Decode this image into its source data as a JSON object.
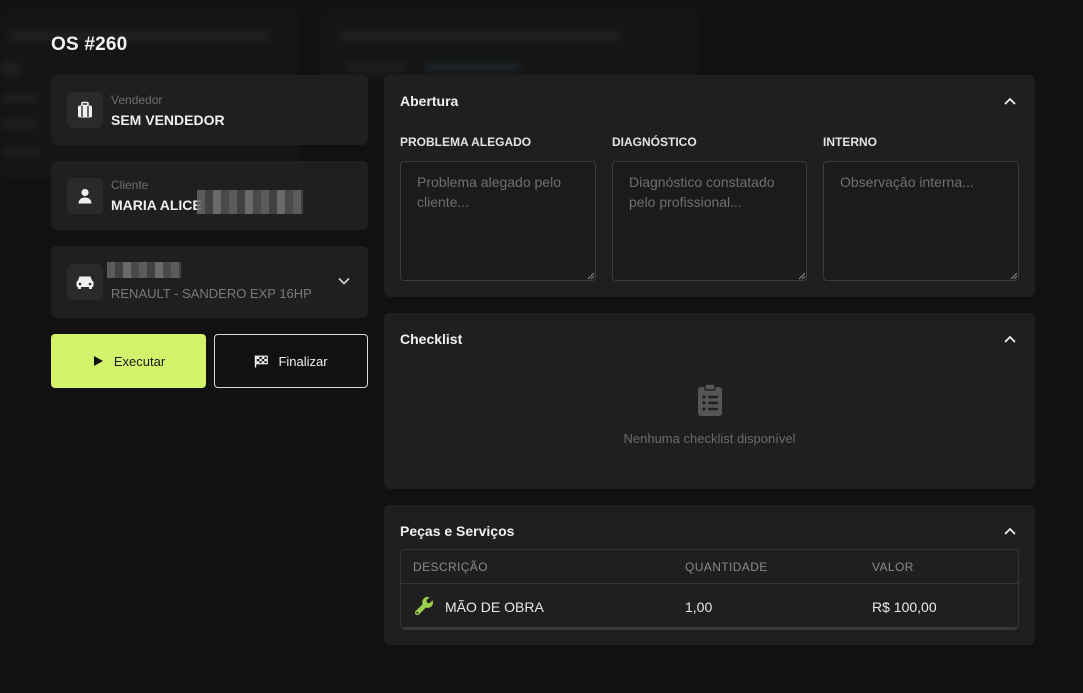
{
  "order": {
    "title": "OS #260"
  },
  "seller": {
    "label": "Vendedor",
    "value": "SEM VENDEDOR"
  },
  "client": {
    "label": "Cliente",
    "name": "MARIA ALICE"
  },
  "vehicle": {
    "model": "RENAULT - SANDERO EXP 16HP"
  },
  "actions": {
    "execute_label": "Executar",
    "finish_label": "Finalizar"
  },
  "abertura": {
    "title": "Abertura",
    "fields": [
      {
        "label": "PROBLEMA ALEGADO",
        "placeholder": "Problema alegado pelo cliente...",
        "value": ""
      },
      {
        "label": "DIAGNÓSTICO",
        "placeholder": "Diagnóstico constatado pelo profissional...",
        "value": ""
      },
      {
        "label": "INTERNO",
        "placeholder": "Observação interna...",
        "value": ""
      }
    ]
  },
  "checklist": {
    "title": "Checklist",
    "empty_text": "Nenhuma checklist disponível"
  },
  "items": {
    "title": "Peças e Serviços",
    "columns": [
      "DESCRIÇÃO",
      "QUANTIDADE",
      "VALOR"
    ],
    "rows": [
      {
        "description": "MÃO DE OBRA",
        "quantity": "1,00",
        "value": "R$ 100,00",
        "icon": "wrench-icon"
      }
    ]
  },
  "colors": {
    "accent": "#d4f36d",
    "background": "#151515",
    "card": "#1f1f1f",
    "wrench": "#9ccf4c"
  }
}
